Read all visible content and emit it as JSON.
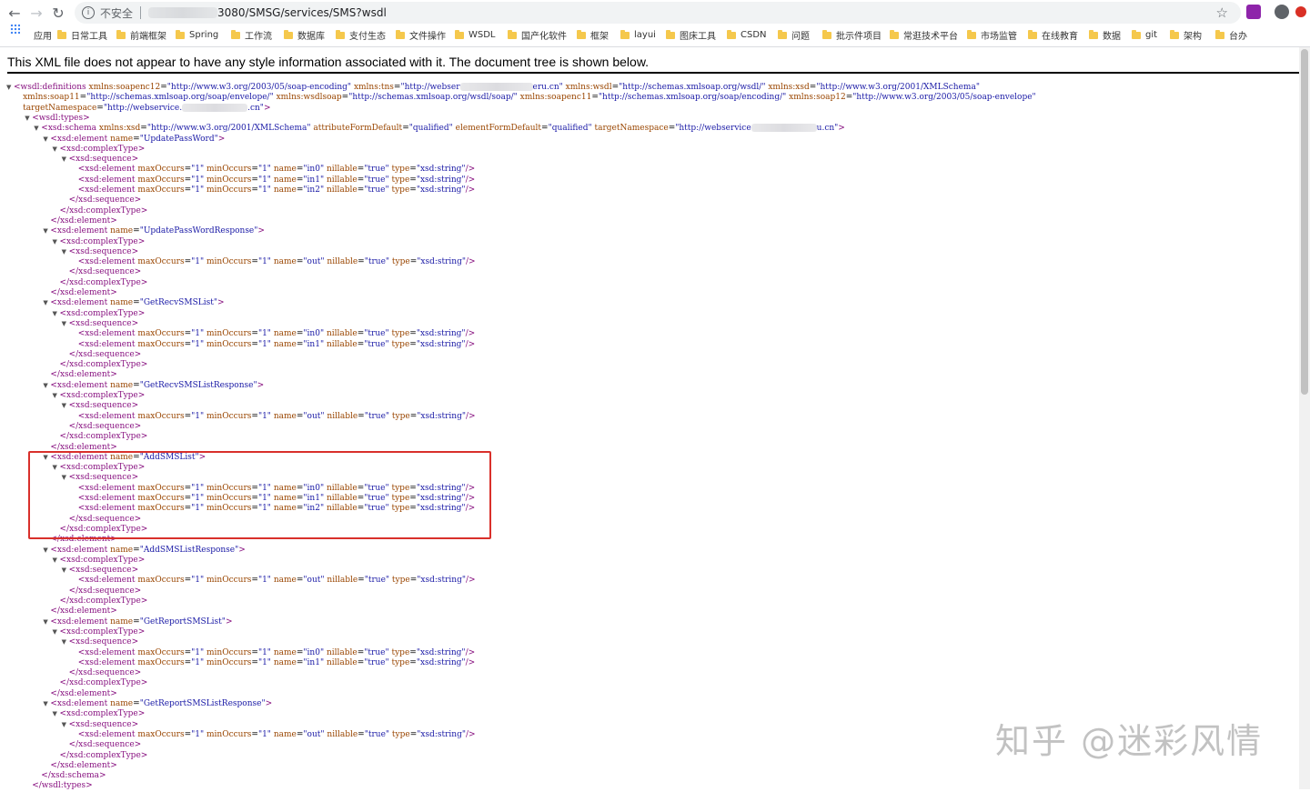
{
  "browser": {
    "insecure_label": "不安全",
    "url_suffix": "3080/SMSG/services/SMS?wsdl"
  },
  "bookmarks": [
    "应用",
    "日常工具",
    "前端框架",
    "Spring",
    "工作流",
    "数据库",
    "支付生态",
    "文件操作",
    "WSDL",
    "国产化软件",
    "框架",
    "layui",
    "图床工具",
    "CSDN",
    "问题",
    "批示件项目",
    "常逛技术平台",
    "市场监管",
    "在线教育",
    "数据",
    "git",
    "架构",
    "台办"
  ],
  "info_message": "This XML file does not appear to have any style information associated with it. The document tree is shown below.",
  "xml_lines": [
    {
      "i": 0,
      "t": "▼",
      "h": "<span class=\"tag\">&lt;wsdl:definitions</span> <span class=\"an\">xmlns:soapenc12</span>=<span class=\"av\">\"http://www.w3.org/2003/05/soap-encoding\"</span> <span class=\"an\">xmlns:tns</span>=<span class=\"av\">\"http://webser<span class=\"blur\" style=\"width:80px\"></span>eru.cn\"</span> <span class=\"an\">xmlns:wsdl</span>=<span class=\"av\">\"http://schemas.xmlsoap.org/wsdl/\"</span> <span class=\"an\">xmlns:xsd</span>=<span class=\"av\">\"http://www.w3.org/2001/XMLSchema\"</span>"
    },
    {
      "i": 1,
      "t": "",
      "h": "<span class=\"an\">xmlns:soap11</span>=<span class=\"av\">\"http://schemas.xmlsoap.org/soap/envelope/\"</span> <span class=\"an\">xmlns:wsdlsoap</span>=<span class=\"av\">\"http://schemas.xmlsoap.org/wsdl/soap/\"</span> <span class=\"an\">xmlns:soapenc11</span>=<span class=\"av\">\"http://schemas.xmlsoap.org/soap/encoding/\"</span> <span class=\"an\">xmlns:soap12</span>=<span class=\"av\">\"http://www.w3.org/2003/05/soap-envelope\"</span>"
    },
    {
      "i": 1,
      "t": "",
      "h": "<span class=\"an\">targetNamespace</span>=<span class=\"av\">\"http://webservice.<span class=\"blur\" style=\"width:72px\"></span>.cn\"</span><span class=\"tag\">&gt;</span>"
    },
    {
      "i": 2,
      "t": "▼",
      "h": "<span class=\"tag\">&lt;wsdl:types&gt;</span>"
    },
    {
      "i": 3,
      "t": "▼",
      "h": "<span class=\"tag\">&lt;xsd:schema</span> <span class=\"an\">xmlns:xsd</span>=<span class=\"av\">\"http://www.w3.org/2001/XMLSchema\"</span> <span class=\"an\">attributeFormDefault</span>=<span class=\"av\">\"qualified\"</span> <span class=\"an\">elementFormDefault</span>=<span class=\"av\">\"qualified\"</span> <span class=\"an\">targetNamespace</span>=<span class=\"av\">\"http://webservice<span class=\"blur\" style=\"width:72px\"></span>u.cn\"</span><span class=\"tag\">&gt;</span>"
    },
    {
      "i": 4,
      "t": "▼",
      "h": "<span class=\"tag\">&lt;xsd:element</span> <span class=\"an\">name</span>=<span class=\"av\">\"UpdatePassWord\"</span><span class=\"tag\">&gt;</span>"
    },
    {
      "i": 5,
      "t": "▼",
      "h": "<span class=\"tag\">&lt;xsd:complexType&gt;</span>"
    },
    {
      "i": 6,
      "t": "▼",
      "h": "<span class=\"tag\">&lt;xsd:sequence&gt;</span>"
    },
    {
      "i": 7,
      "t": "",
      "h": "<span class=\"tag\">&lt;xsd:element</span> <span class=\"an\">maxOccurs</span>=<span class=\"av\">\"1\"</span> <span class=\"an\">minOccurs</span>=<span class=\"av\">\"1\"</span> <span class=\"an\">name</span>=<span class=\"av\">\"in0\"</span> <span class=\"an\">nillable</span>=<span class=\"av\">\"true\"</span> <span class=\"an\">type</span>=<span class=\"av\">\"xsd:string\"</span><span class=\"tag\">/&gt;</span>"
    },
    {
      "i": 7,
      "t": "",
      "h": "<span class=\"tag\">&lt;xsd:element</span> <span class=\"an\">maxOccurs</span>=<span class=\"av\">\"1\"</span> <span class=\"an\">minOccurs</span>=<span class=\"av\">\"1\"</span> <span class=\"an\">name</span>=<span class=\"av\">\"in1\"</span> <span class=\"an\">nillable</span>=<span class=\"av\">\"true\"</span> <span class=\"an\">type</span>=<span class=\"av\">\"xsd:string\"</span><span class=\"tag\">/&gt;</span>"
    },
    {
      "i": 7,
      "t": "",
      "h": "<span class=\"tag\">&lt;xsd:element</span> <span class=\"an\">maxOccurs</span>=<span class=\"av\">\"1\"</span> <span class=\"an\">minOccurs</span>=<span class=\"av\">\"1\"</span> <span class=\"an\">name</span>=<span class=\"av\">\"in2\"</span> <span class=\"an\">nillable</span>=<span class=\"av\">\"true\"</span> <span class=\"an\">type</span>=<span class=\"av\">\"xsd:string\"</span><span class=\"tag\">/&gt;</span>"
    },
    {
      "i": 6,
      "t": "",
      "h": "<span class=\"tag\">&lt;/xsd:sequence&gt;</span>"
    },
    {
      "i": 5,
      "t": "",
      "h": "<span class=\"tag\">&lt;/xsd:complexType&gt;</span>"
    },
    {
      "i": 4,
      "t": "",
      "h": "<span class=\"tag\">&lt;/xsd:element&gt;</span>"
    },
    {
      "i": 4,
      "t": "▼",
      "h": "<span class=\"tag\">&lt;xsd:element</span> <span class=\"an\">name</span>=<span class=\"av\">\"UpdatePassWordResponse\"</span><span class=\"tag\">&gt;</span>"
    },
    {
      "i": 5,
      "t": "▼",
      "h": "<span class=\"tag\">&lt;xsd:complexType&gt;</span>"
    },
    {
      "i": 6,
      "t": "▼",
      "h": "<span class=\"tag\">&lt;xsd:sequence&gt;</span>"
    },
    {
      "i": 7,
      "t": "",
      "h": "<span class=\"tag\">&lt;xsd:element</span> <span class=\"an\">maxOccurs</span>=<span class=\"av\">\"1\"</span> <span class=\"an\">minOccurs</span>=<span class=\"av\">\"1\"</span> <span class=\"an\">name</span>=<span class=\"av\">\"out\"</span> <span class=\"an\">nillable</span>=<span class=\"av\">\"true\"</span> <span class=\"an\">type</span>=<span class=\"av\">\"xsd:string\"</span><span class=\"tag\">/&gt;</span>"
    },
    {
      "i": 6,
      "t": "",
      "h": "<span class=\"tag\">&lt;/xsd:sequence&gt;</span>"
    },
    {
      "i": 5,
      "t": "",
      "h": "<span class=\"tag\">&lt;/xsd:complexType&gt;</span>"
    },
    {
      "i": 4,
      "t": "",
      "h": "<span class=\"tag\">&lt;/xsd:element&gt;</span>"
    },
    {
      "i": 4,
      "t": "▼",
      "h": "<span class=\"tag\">&lt;xsd:element</span> <span class=\"an\">name</span>=<span class=\"av\">\"GetRecvSMSList\"</span><span class=\"tag\">&gt;</span>"
    },
    {
      "i": 5,
      "t": "▼",
      "h": "<span class=\"tag\">&lt;xsd:complexType&gt;</span>"
    },
    {
      "i": 6,
      "t": "▼",
      "h": "<span class=\"tag\">&lt;xsd:sequence&gt;</span>"
    },
    {
      "i": 7,
      "t": "",
      "h": "<span class=\"tag\">&lt;xsd:element</span> <span class=\"an\">maxOccurs</span>=<span class=\"av\">\"1\"</span> <span class=\"an\">minOccurs</span>=<span class=\"av\">\"1\"</span> <span class=\"an\">name</span>=<span class=\"av\">\"in0\"</span> <span class=\"an\">nillable</span>=<span class=\"av\">\"true\"</span> <span class=\"an\">type</span>=<span class=\"av\">\"xsd:string\"</span><span class=\"tag\">/&gt;</span>"
    },
    {
      "i": 7,
      "t": "",
      "h": "<span class=\"tag\">&lt;xsd:element</span> <span class=\"an\">maxOccurs</span>=<span class=\"av\">\"1\"</span> <span class=\"an\">minOccurs</span>=<span class=\"av\">\"1\"</span> <span class=\"an\">name</span>=<span class=\"av\">\"in1\"</span> <span class=\"an\">nillable</span>=<span class=\"av\">\"true\"</span> <span class=\"an\">type</span>=<span class=\"av\">\"xsd:string\"</span><span class=\"tag\">/&gt;</span>"
    },
    {
      "i": 6,
      "t": "",
      "h": "<span class=\"tag\">&lt;/xsd:sequence&gt;</span>"
    },
    {
      "i": 5,
      "t": "",
      "h": "<span class=\"tag\">&lt;/xsd:complexType&gt;</span>"
    },
    {
      "i": 4,
      "t": "",
      "h": "<span class=\"tag\">&lt;/xsd:element&gt;</span>"
    },
    {
      "i": 4,
      "t": "▼",
      "h": "<span class=\"tag\">&lt;xsd:element</span> <span class=\"an\">name</span>=<span class=\"av\">\"GetRecvSMSListResponse\"</span><span class=\"tag\">&gt;</span>"
    },
    {
      "i": 5,
      "t": "▼",
      "h": "<span class=\"tag\">&lt;xsd:complexType&gt;</span>"
    },
    {
      "i": 6,
      "t": "▼",
      "h": "<span class=\"tag\">&lt;xsd:sequence&gt;</span>"
    },
    {
      "i": 7,
      "t": "",
      "h": "<span class=\"tag\">&lt;xsd:element</span> <span class=\"an\">maxOccurs</span>=<span class=\"av\">\"1\"</span> <span class=\"an\">minOccurs</span>=<span class=\"av\">\"1\"</span> <span class=\"an\">name</span>=<span class=\"av\">\"out\"</span> <span class=\"an\">nillable</span>=<span class=\"av\">\"true\"</span> <span class=\"an\">type</span>=<span class=\"av\">\"xsd:string\"</span><span class=\"tag\">/&gt;</span>"
    },
    {
      "i": 6,
      "t": "",
      "h": "<span class=\"tag\">&lt;/xsd:sequence&gt;</span>"
    },
    {
      "i": 5,
      "t": "",
      "h": "<span class=\"tag\">&lt;/xsd:complexType&gt;</span>"
    },
    {
      "i": 4,
      "t": "",
      "h": "<span class=\"tag\">&lt;/xsd:element&gt;</span>"
    },
    {
      "i": 4,
      "t": "▼",
      "h": "<span class=\"tag\">&lt;xsd:element</span> <span class=\"an\">name</span>=<span class=\"av\">\"AddSMSList\"</span><span class=\"tag\">&gt;</span>"
    },
    {
      "i": 5,
      "t": "▼",
      "h": "<span class=\"tag\">&lt;xsd:complexType&gt;</span>"
    },
    {
      "i": 6,
      "t": "▼",
      "h": "<span class=\"tag\">&lt;xsd:sequence&gt;</span>"
    },
    {
      "i": 7,
      "t": "",
      "h": "<span class=\"tag\">&lt;xsd:element</span> <span class=\"an\">maxOccurs</span>=<span class=\"av\">\"1\"</span> <span class=\"an\">minOccurs</span>=<span class=\"av\">\"1\"</span> <span class=\"an\">name</span>=<span class=\"av\">\"in0\"</span> <span class=\"an\">nillable</span>=<span class=\"av\">\"true\"</span> <span class=\"an\">type</span>=<span class=\"av\">\"xsd:string\"</span><span class=\"tag\">/&gt;</span>"
    },
    {
      "i": 7,
      "t": "",
      "h": "<span class=\"tag\">&lt;xsd:element</span> <span class=\"an\">maxOccurs</span>=<span class=\"av\">\"1\"</span> <span class=\"an\">minOccurs</span>=<span class=\"av\">\"1\"</span> <span class=\"an\">name</span>=<span class=\"av\">\"in1\"</span> <span class=\"an\">nillable</span>=<span class=\"av\">\"true\"</span> <span class=\"an\">type</span>=<span class=\"av\">\"xsd:string\"</span><span class=\"tag\">/&gt;</span>"
    },
    {
      "i": 7,
      "t": "",
      "h": "<span class=\"tag\">&lt;xsd:element</span> <span class=\"an\">maxOccurs</span>=<span class=\"av\">\"1\"</span> <span class=\"an\">minOccurs</span>=<span class=\"av\">\"1\"</span> <span class=\"an\">name</span>=<span class=\"av\">\"in2\"</span> <span class=\"an\">nillable</span>=<span class=\"av\">\"true\"</span> <span class=\"an\">type</span>=<span class=\"av\">\"xsd:string\"</span><span class=\"tag\">/&gt;</span>"
    },
    {
      "i": 6,
      "t": "",
      "h": "<span class=\"tag\">&lt;/xsd:sequence&gt;</span>"
    },
    {
      "i": 5,
      "t": "",
      "h": "<span class=\"tag\">&lt;/xsd:complexType&gt;</span>"
    },
    {
      "i": 4,
      "t": "",
      "h": "<span class=\"tag\">&lt;/xsd:element&gt;</span>"
    },
    {
      "i": 4,
      "t": "▼",
      "h": "<span class=\"tag\">&lt;xsd:element</span> <span class=\"an\">name</span>=<span class=\"av\">\"AddSMSListResponse\"</span><span class=\"tag\">&gt;</span>"
    },
    {
      "i": 5,
      "t": "▼",
      "h": "<span class=\"tag\">&lt;xsd:complexType&gt;</span>"
    },
    {
      "i": 6,
      "t": "▼",
      "h": "<span class=\"tag\">&lt;xsd:sequence&gt;</span>"
    },
    {
      "i": 7,
      "t": "",
      "h": "<span class=\"tag\">&lt;xsd:element</span> <span class=\"an\">maxOccurs</span>=<span class=\"av\">\"1\"</span> <span class=\"an\">minOccurs</span>=<span class=\"av\">\"1\"</span> <span class=\"an\">name</span>=<span class=\"av\">\"out\"</span> <span class=\"an\">nillable</span>=<span class=\"av\">\"true\"</span> <span class=\"an\">type</span>=<span class=\"av\">\"xsd:string\"</span><span class=\"tag\">/&gt;</span>"
    },
    {
      "i": 6,
      "t": "",
      "h": "<span class=\"tag\">&lt;/xsd:sequence&gt;</span>"
    },
    {
      "i": 5,
      "t": "",
      "h": "<span class=\"tag\">&lt;/xsd:complexType&gt;</span>"
    },
    {
      "i": 4,
      "t": "",
      "h": "<span class=\"tag\">&lt;/xsd:element&gt;</span>"
    },
    {
      "i": 4,
      "t": "▼",
      "h": "<span class=\"tag\">&lt;xsd:element</span> <span class=\"an\">name</span>=<span class=\"av\">\"GetReportSMSList\"</span><span class=\"tag\">&gt;</span>"
    },
    {
      "i": 5,
      "t": "▼",
      "h": "<span class=\"tag\">&lt;xsd:complexType&gt;</span>"
    },
    {
      "i": 6,
      "t": "▼",
      "h": "<span class=\"tag\">&lt;xsd:sequence&gt;</span>"
    },
    {
      "i": 7,
      "t": "",
      "h": "<span class=\"tag\">&lt;xsd:element</span> <span class=\"an\">maxOccurs</span>=<span class=\"av\">\"1\"</span> <span class=\"an\">minOccurs</span>=<span class=\"av\">\"1\"</span> <span class=\"an\">name</span>=<span class=\"av\">\"in0\"</span> <span class=\"an\">nillable</span>=<span class=\"av\">\"true\"</span> <span class=\"an\">type</span>=<span class=\"av\">\"xsd:string\"</span><span class=\"tag\">/&gt;</span>"
    },
    {
      "i": 7,
      "t": "",
      "h": "<span class=\"tag\">&lt;xsd:element</span> <span class=\"an\">maxOccurs</span>=<span class=\"av\">\"1\"</span> <span class=\"an\">minOccurs</span>=<span class=\"av\">\"1\"</span> <span class=\"an\">name</span>=<span class=\"av\">\"in1\"</span> <span class=\"an\">nillable</span>=<span class=\"av\">\"true\"</span> <span class=\"an\">type</span>=<span class=\"av\">\"xsd:string\"</span><span class=\"tag\">/&gt;</span>"
    },
    {
      "i": 6,
      "t": "",
      "h": "<span class=\"tag\">&lt;/xsd:sequence&gt;</span>"
    },
    {
      "i": 5,
      "t": "",
      "h": "<span class=\"tag\">&lt;/xsd:complexType&gt;</span>"
    },
    {
      "i": 4,
      "t": "",
      "h": "<span class=\"tag\">&lt;/xsd:element&gt;</span>"
    },
    {
      "i": 4,
      "t": "▼",
      "h": "<span class=\"tag\">&lt;xsd:element</span> <span class=\"an\">name</span>=<span class=\"av\">\"GetReportSMSListResponse\"</span><span class=\"tag\">&gt;</span>"
    },
    {
      "i": 5,
      "t": "▼",
      "h": "<span class=\"tag\">&lt;xsd:complexType&gt;</span>"
    },
    {
      "i": 6,
      "t": "▼",
      "h": "<span class=\"tag\">&lt;xsd:sequence&gt;</span>"
    },
    {
      "i": 7,
      "t": "",
      "h": "<span class=\"tag\">&lt;xsd:element</span> <span class=\"an\">maxOccurs</span>=<span class=\"av\">\"1\"</span> <span class=\"an\">minOccurs</span>=<span class=\"av\">\"1\"</span> <span class=\"an\">name</span>=<span class=\"av\">\"out\"</span> <span class=\"an\">nillable</span>=<span class=\"av\">\"true\"</span> <span class=\"an\">type</span>=<span class=\"av\">\"xsd:string\"</span><span class=\"tag\">/&gt;</span>"
    },
    {
      "i": 6,
      "t": "",
      "h": "<span class=\"tag\">&lt;/xsd:sequence&gt;</span>"
    },
    {
      "i": 5,
      "t": "",
      "h": "<span class=\"tag\">&lt;/xsd:complexType&gt;</span>"
    },
    {
      "i": 4,
      "t": "",
      "h": "<span class=\"tag\">&lt;/xsd:element&gt;</span>"
    },
    {
      "i": 3,
      "t": "",
      "h": "<span class=\"tag\">&lt;/xsd:schema&gt;</span>"
    },
    {
      "i": 2,
      "t": "",
      "h": "<span class=\"tag\">&lt;/wsdl:types&gt;</span>"
    }
  ],
  "watermark": "知乎 @迷彩风情"
}
